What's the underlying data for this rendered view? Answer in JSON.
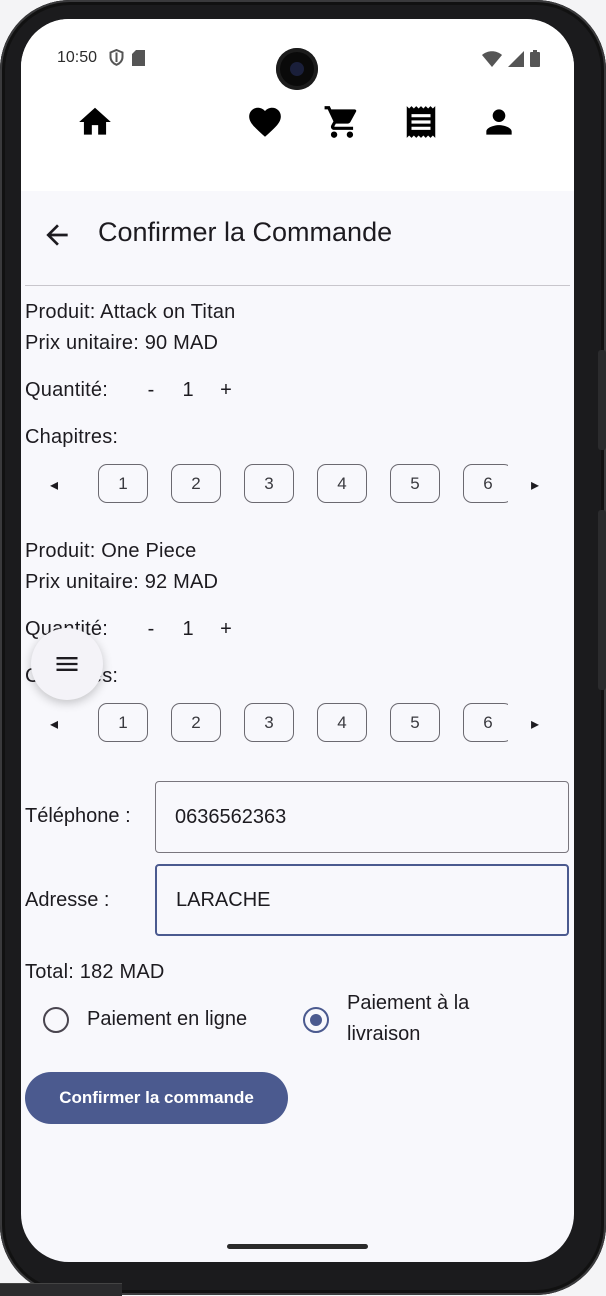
{
  "status_bar": {
    "time": "10:50"
  },
  "nav": {
    "icons": [
      "home-icon",
      "heart-icon",
      "cart-icon",
      "receipt-icon",
      "person-icon"
    ]
  },
  "header": {
    "title": "Confirmer la Commande"
  },
  "products": [
    {
      "name_line": "Produit: Attack on Titan",
      "price_line": "Prix unitaire: 90 MAD",
      "quantity_label": "Quantité:",
      "minus": "-",
      "quantity": "1",
      "plus": "+",
      "chapters_label": "Chapitres:",
      "prev_arrow": "◂",
      "next_arrow": "▸",
      "chapters": [
        "1",
        "2",
        "3",
        "4",
        "5",
        "6"
      ]
    },
    {
      "name_line": "Produit: One Piece",
      "price_line": "Prix unitaire: 92 MAD",
      "quantity_label": "Quantité:",
      "minus": "-",
      "quantity": "1",
      "plus": "+",
      "chapters_label": "Chapitres:",
      "prev_arrow": "◂",
      "next_arrow": "▸",
      "chapters": [
        "1",
        "2",
        "3",
        "4",
        "5",
        "6"
      ]
    }
  ],
  "form": {
    "phone_label": "Téléphone :",
    "phone_value": "0636562363",
    "address_label": "Adresse :",
    "address_value": "LARACHE"
  },
  "total": "Total: 182 MAD",
  "payment": {
    "online_label": "Paiement en ligne",
    "delivery_label_line1": "Paiement à la",
    "delivery_label_line2": "livraison",
    "selected": "delivery"
  },
  "confirm_button": "Confirmer la commande",
  "colors": {
    "primary": "#4b5a8f",
    "background": "#f8f8fc"
  }
}
